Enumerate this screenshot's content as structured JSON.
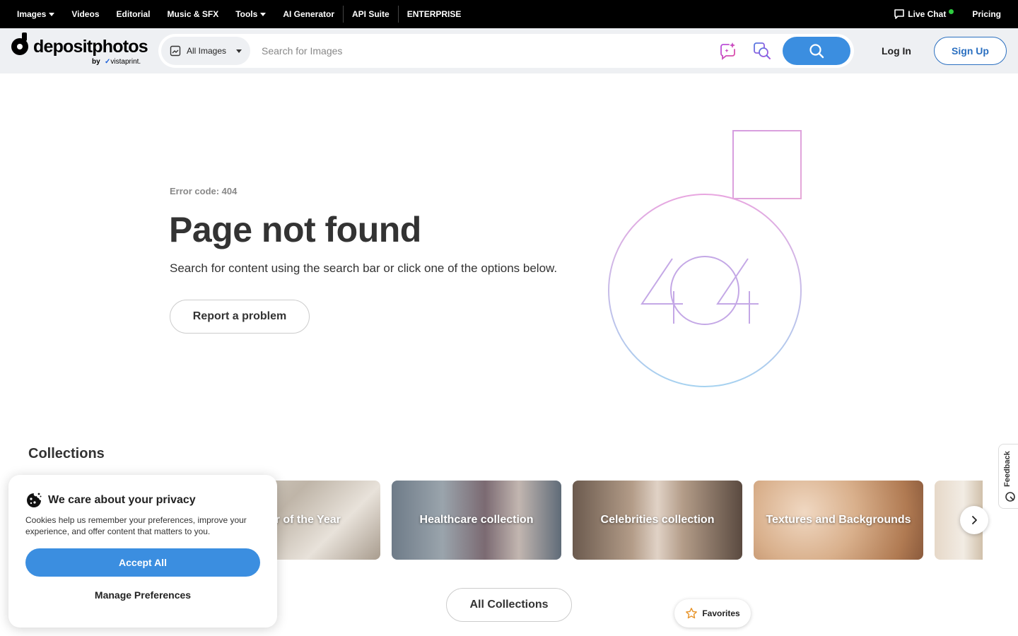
{
  "topnav": {
    "items": [
      {
        "label": "Images",
        "dropdown": true
      },
      {
        "label": "Videos"
      },
      {
        "label": "Editorial"
      },
      {
        "label": "Music & SFX"
      },
      {
        "label": "Tools",
        "dropdown": true
      },
      {
        "label": "AI Generator"
      },
      {
        "label": "API Suite"
      },
      {
        "label": "ENTERPRISE"
      }
    ],
    "live_chat": "Live Chat",
    "pricing": "Pricing"
  },
  "header": {
    "logo_name": "depositphotos",
    "logo_by": "by",
    "logo_partner": "vistaprint.",
    "search_type": "All Images",
    "search_placeholder": "Search for Images",
    "login": "Log In",
    "signup": "Sign Up"
  },
  "error": {
    "code": "Error code: 404",
    "title": "Page not found",
    "subtitle": "Search for content using the search bar or click one of the options below.",
    "report_button": "Report a problem"
  },
  "collections": {
    "title": "Collections",
    "cards": [
      {
        "label": "Color of the Year"
      },
      {
        "label": "Healthcare collection"
      },
      {
        "label": "Celebrities collection"
      },
      {
        "label": "Textures and Backgrounds"
      },
      {
        "label": ""
      }
    ],
    "all_button": "All Collections"
  },
  "favorites": "Favorites",
  "feedback": "Feedback",
  "cookie": {
    "title": "We care about your privacy",
    "text": "Cookies help us remember your preferences, improve your experience, and offer content that matters to you.",
    "accept": "Accept All",
    "manage": "Manage Preferences"
  },
  "colors": {
    "accent": "#3b8ee0",
    "signup_border": "#2a6fc0",
    "topbar": "#000000"
  }
}
